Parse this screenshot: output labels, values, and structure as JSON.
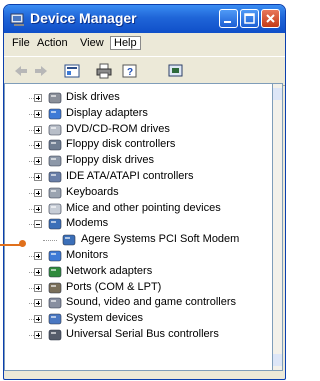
{
  "window": {
    "title": "Device Manager"
  },
  "colors": {
    "titlebar": "#1f65d8",
    "callout": "#e0701c",
    "tree_bg": "#ffffff"
  },
  "menus": [
    "File",
    "Action",
    "View",
    "Help"
  ],
  "toolbar": {
    "icons": [
      "back-icon",
      "forward-icon",
      "properties-icon",
      "print-icon",
      "help-icon",
      "scan-icon"
    ]
  },
  "tree": {
    "items": [
      {
        "label": "Disk drives",
        "icon": "disk-drive-icon",
        "expanded": false
      },
      {
        "label": "Display adapters",
        "icon": "display-adapter-icon",
        "expanded": false
      },
      {
        "label": "DVD/CD-ROM drives",
        "icon": "cdrom-icon",
        "expanded": false
      },
      {
        "label": "Floppy disk controllers",
        "icon": "floppy-controller-icon",
        "expanded": false
      },
      {
        "label": "Floppy disk drives",
        "icon": "floppy-drive-icon",
        "expanded": false
      },
      {
        "label": "IDE ATA/ATAPI controllers",
        "icon": "ide-controller-icon",
        "expanded": false
      },
      {
        "label": "Keyboards",
        "icon": "keyboard-icon",
        "expanded": false
      },
      {
        "label": "Mice and other pointing devices",
        "icon": "mouse-icon",
        "expanded": false
      },
      {
        "label": "Modems",
        "icon": "modem-icon",
        "expanded": true
      },
      {
        "label": "Agere Systems PCI Soft Modem",
        "icon": "modem-device-icon",
        "child": true
      },
      {
        "label": "Monitors",
        "icon": "monitor-icon",
        "expanded": false
      },
      {
        "label": "Network adapters",
        "icon": "network-adapter-icon",
        "expanded": false
      },
      {
        "label": "Ports (COM & LPT)",
        "icon": "port-icon",
        "expanded": false
      },
      {
        "label": "Sound, video and game controllers",
        "icon": "sound-icon",
        "expanded": false
      },
      {
        "label": "System devices",
        "icon": "system-device-icon",
        "expanded": false
      },
      {
        "label": "Universal Serial Bus controllers",
        "icon": "usb-icon",
        "expanded": false
      }
    ]
  }
}
